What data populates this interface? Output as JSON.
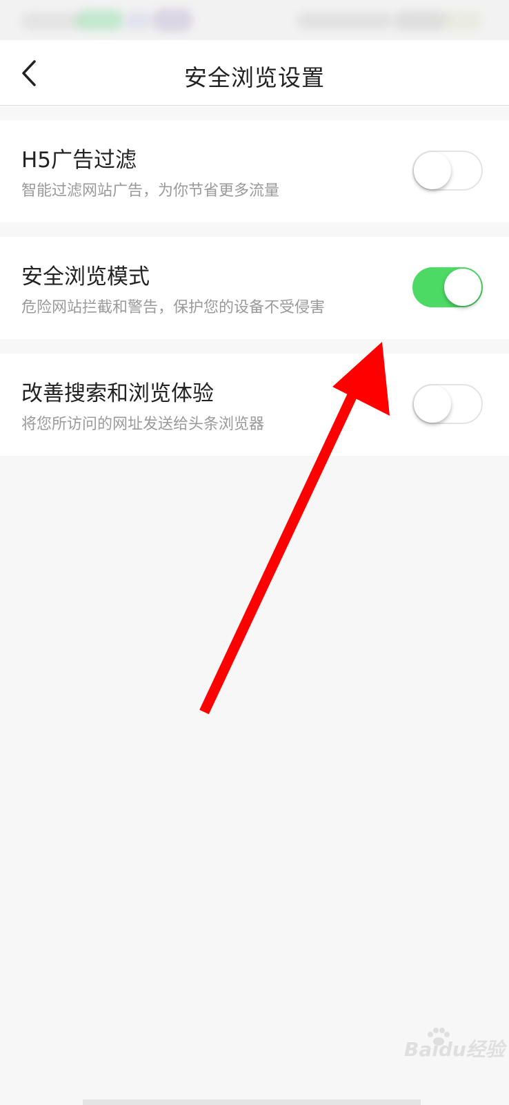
{
  "header": {
    "title": "安全浏览设置",
    "back_icon": "chevron-left-icon"
  },
  "settings": [
    {
      "title": "H5广告过滤",
      "description": "智能过滤网站广告，为你节省更多流量",
      "enabled": false
    },
    {
      "title": "安全浏览模式",
      "description": "危险网站拦截和警告，保护您的设备不受侵害",
      "enabled": true
    },
    {
      "title": "改善搜索和浏览体验",
      "description": "将您所访问的网址发送给头条浏览器",
      "enabled": false
    }
  ],
  "annotation": {
    "arrow_color": "#ff0000"
  },
  "watermark": {
    "text": "Baidu经验"
  },
  "colors": {
    "toggle_on": "#4cd964",
    "toggle_off_border": "#e3e3e3",
    "page_background": "#f7f7f7"
  }
}
